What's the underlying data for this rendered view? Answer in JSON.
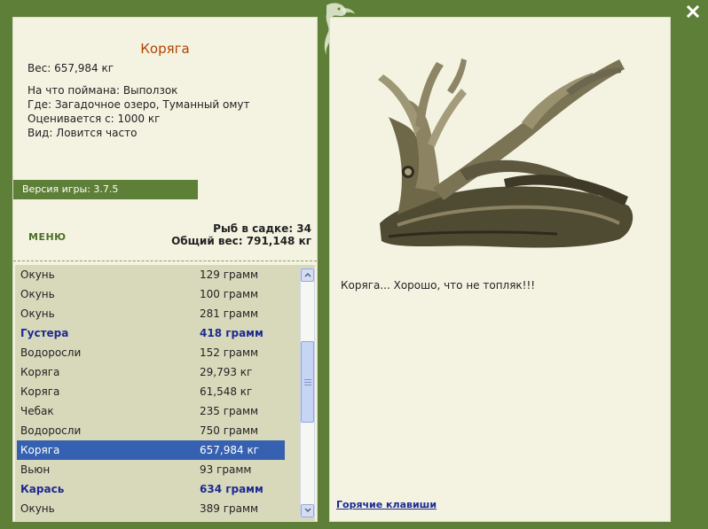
{
  "info": {
    "title": "Коряга",
    "weight": "Вес: 657,984 кг",
    "lines": [
      "На что поймана: Выползок",
      "Где: Загадочное озеро, Туманный омут",
      "Оценивается с: 1000 кг",
      "Вид: Ловится часто"
    ]
  },
  "version": "Версия игры: 3.7.5",
  "menu_label": "МЕНЮ",
  "stats": {
    "fish_count": "Рыб в садке: 34",
    "total_weight": "Общий вес: 791,148 кг"
  },
  "catch_list": [
    {
      "name": "Окунь",
      "weight": "129 грамм",
      "bold": false,
      "selected": false
    },
    {
      "name": "Окунь",
      "weight": "100 грамм",
      "bold": false,
      "selected": false
    },
    {
      "name": "Окунь",
      "weight": "281 грамм",
      "bold": false,
      "selected": false
    },
    {
      "name": "Густера",
      "weight": "418 грамм",
      "bold": true,
      "selected": false
    },
    {
      "name": "Водоросли",
      "weight": "152 грамм",
      "bold": false,
      "selected": false
    },
    {
      "name": "Коряга",
      "weight": "29,793 кг",
      "bold": false,
      "selected": false
    },
    {
      "name": "Коряга",
      "weight": "61,548 кг",
      "bold": false,
      "selected": false
    },
    {
      "name": "Чебак",
      "weight": "235 грамм",
      "bold": false,
      "selected": false
    },
    {
      "name": "Водоросли",
      "weight": "750 грамм",
      "bold": false,
      "selected": false
    },
    {
      "name": "Коряга",
      "weight": "657,984 кг",
      "bold": false,
      "selected": true
    },
    {
      "name": "Вьюн",
      "weight": "93 грамм",
      "bold": false,
      "selected": false
    },
    {
      "name": "Карась",
      "weight": "634 грамм",
      "bold": true,
      "selected": false
    },
    {
      "name": "Окунь",
      "weight": "389 грамм",
      "bold": false,
      "selected": false
    }
  ],
  "caption": "Коряга... Хорошо, что не топляк!!!",
  "hotkeys_label": "Горячие клавиши",
  "colors": {
    "frame_green": "#5e7f38",
    "panel_bg": "#f4f3e2",
    "title_orange": "#b24300",
    "bold_blue": "#1d2a91",
    "selection_blue": "#3661b0"
  },
  "icons": {
    "close": "close-x-icon",
    "logo": "lizard-logo-icon"
  }
}
